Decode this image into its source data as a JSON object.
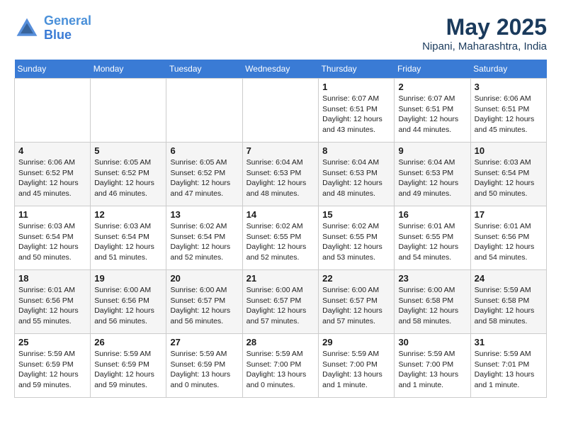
{
  "header": {
    "logo_line1": "General",
    "logo_line2": "Blue",
    "month": "May 2025",
    "location": "Nipani, Maharashtra, India"
  },
  "weekdays": [
    "Sunday",
    "Monday",
    "Tuesday",
    "Wednesday",
    "Thursday",
    "Friday",
    "Saturday"
  ],
  "weeks": [
    [
      {
        "day": "",
        "info": ""
      },
      {
        "day": "",
        "info": ""
      },
      {
        "day": "",
        "info": ""
      },
      {
        "day": "",
        "info": ""
      },
      {
        "day": "1",
        "info": "Sunrise: 6:07 AM\nSunset: 6:51 PM\nDaylight: 12 hours\nand 43 minutes."
      },
      {
        "day": "2",
        "info": "Sunrise: 6:07 AM\nSunset: 6:51 PM\nDaylight: 12 hours\nand 44 minutes."
      },
      {
        "day": "3",
        "info": "Sunrise: 6:06 AM\nSunset: 6:51 PM\nDaylight: 12 hours\nand 45 minutes."
      }
    ],
    [
      {
        "day": "4",
        "info": "Sunrise: 6:06 AM\nSunset: 6:52 PM\nDaylight: 12 hours\nand 45 minutes."
      },
      {
        "day": "5",
        "info": "Sunrise: 6:05 AM\nSunset: 6:52 PM\nDaylight: 12 hours\nand 46 minutes."
      },
      {
        "day": "6",
        "info": "Sunrise: 6:05 AM\nSunset: 6:52 PM\nDaylight: 12 hours\nand 47 minutes."
      },
      {
        "day": "7",
        "info": "Sunrise: 6:04 AM\nSunset: 6:53 PM\nDaylight: 12 hours\nand 48 minutes."
      },
      {
        "day": "8",
        "info": "Sunrise: 6:04 AM\nSunset: 6:53 PM\nDaylight: 12 hours\nand 48 minutes."
      },
      {
        "day": "9",
        "info": "Sunrise: 6:04 AM\nSunset: 6:53 PM\nDaylight: 12 hours\nand 49 minutes."
      },
      {
        "day": "10",
        "info": "Sunrise: 6:03 AM\nSunset: 6:54 PM\nDaylight: 12 hours\nand 50 minutes."
      }
    ],
    [
      {
        "day": "11",
        "info": "Sunrise: 6:03 AM\nSunset: 6:54 PM\nDaylight: 12 hours\nand 50 minutes."
      },
      {
        "day": "12",
        "info": "Sunrise: 6:03 AM\nSunset: 6:54 PM\nDaylight: 12 hours\nand 51 minutes."
      },
      {
        "day": "13",
        "info": "Sunrise: 6:02 AM\nSunset: 6:54 PM\nDaylight: 12 hours\nand 52 minutes."
      },
      {
        "day": "14",
        "info": "Sunrise: 6:02 AM\nSunset: 6:55 PM\nDaylight: 12 hours\nand 52 minutes."
      },
      {
        "day": "15",
        "info": "Sunrise: 6:02 AM\nSunset: 6:55 PM\nDaylight: 12 hours\nand 53 minutes."
      },
      {
        "day": "16",
        "info": "Sunrise: 6:01 AM\nSunset: 6:55 PM\nDaylight: 12 hours\nand 54 minutes."
      },
      {
        "day": "17",
        "info": "Sunrise: 6:01 AM\nSunset: 6:56 PM\nDaylight: 12 hours\nand 54 minutes."
      }
    ],
    [
      {
        "day": "18",
        "info": "Sunrise: 6:01 AM\nSunset: 6:56 PM\nDaylight: 12 hours\nand 55 minutes."
      },
      {
        "day": "19",
        "info": "Sunrise: 6:00 AM\nSunset: 6:56 PM\nDaylight: 12 hours\nand 56 minutes."
      },
      {
        "day": "20",
        "info": "Sunrise: 6:00 AM\nSunset: 6:57 PM\nDaylight: 12 hours\nand 56 minutes."
      },
      {
        "day": "21",
        "info": "Sunrise: 6:00 AM\nSunset: 6:57 PM\nDaylight: 12 hours\nand 57 minutes."
      },
      {
        "day": "22",
        "info": "Sunrise: 6:00 AM\nSunset: 6:57 PM\nDaylight: 12 hours\nand 57 minutes."
      },
      {
        "day": "23",
        "info": "Sunrise: 6:00 AM\nSunset: 6:58 PM\nDaylight: 12 hours\nand 58 minutes."
      },
      {
        "day": "24",
        "info": "Sunrise: 5:59 AM\nSunset: 6:58 PM\nDaylight: 12 hours\nand 58 minutes."
      }
    ],
    [
      {
        "day": "25",
        "info": "Sunrise: 5:59 AM\nSunset: 6:59 PM\nDaylight: 12 hours\nand 59 minutes."
      },
      {
        "day": "26",
        "info": "Sunrise: 5:59 AM\nSunset: 6:59 PM\nDaylight: 12 hours\nand 59 minutes."
      },
      {
        "day": "27",
        "info": "Sunrise: 5:59 AM\nSunset: 6:59 PM\nDaylight: 13 hours\nand 0 minutes."
      },
      {
        "day": "28",
        "info": "Sunrise: 5:59 AM\nSunset: 7:00 PM\nDaylight: 13 hours\nand 0 minutes."
      },
      {
        "day": "29",
        "info": "Sunrise: 5:59 AM\nSunset: 7:00 PM\nDaylight: 13 hours\nand 1 minute."
      },
      {
        "day": "30",
        "info": "Sunrise: 5:59 AM\nSunset: 7:00 PM\nDaylight: 13 hours\nand 1 minute."
      },
      {
        "day": "31",
        "info": "Sunrise: 5:59 AM\nSunset: 7:01 PM\nDaylight: 13 hours\nand 1 minute."
      }
    ]
  ]
}
